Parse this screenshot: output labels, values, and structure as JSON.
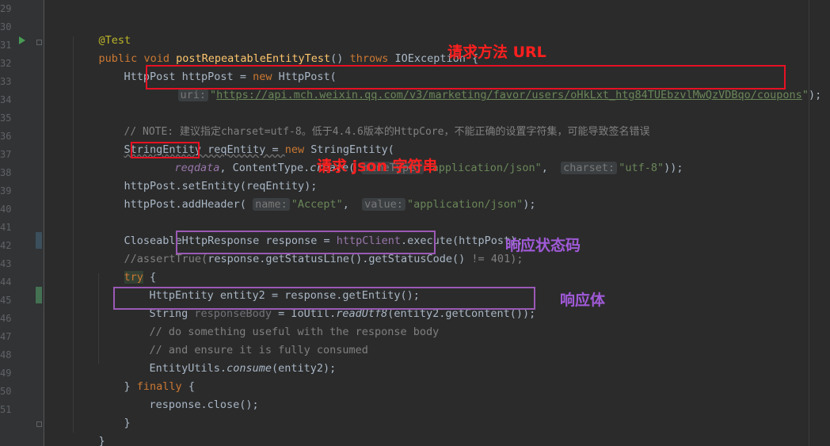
{
  "gutter": {
    "line_numbers": [
      "29",
      "30",
      "31",
      "32",
      "33",
      "34",
      "35",
      "36",
      "37",
      "38",
      "39",
      "40",
      "41",
      "42",
      "43",
      "44",
      "45",
      "46",
      "47",
      "48",
      "49",
      "50",
      "51"
    ]
  },
  "code": {
    "l29_annotation": "@Test",
    "l30_public": "public",
    "l30_void": "void",
    "l30_method": "postRepeatableEntityTest",
    "l30_parens": "() ",
    "l30_throws": "throws",
    "l30_rest": " IOException {",
    "l31_a": "HttpPost httpPost = ",
    "l31_new": "new",
    "l31_b": " HttpPost(",
    "l32_hint": "uri:",
    "l32_q1": "\"",
    "l32_url": "https://api.mch.weixin.qq.com/v3/marketing/favor/users/oHkLxt_htg84TUEbzvlMwQzVDBqo/coupons",
    "l32_q2": "\"",
    "l32_end": ");",
    "l34_comment": "// NOTE: 建议指定charset=utf-8。低于4.4.6版本的HttpCore，不能正确的设置字符集，可能导致签名错误",
    "l35_a": "StringEntity reqEntity = ",
    "l35_new": "new",
    "l35_b": " StringEntity(",
    "l36_param": "reqdata",
    "l36_a": ", ContentType.",
    "l36_create": "create",
    "l36_open": "(",
    "l36_hint1": "mimeType:",
    "l36_str1": "\"application/json\"",
    "l36_comma": ", ",
    "l36_hint2": "charset:",
    "l36_str2": "\"utf-8\"",
    "l36_end": "));",
    "l37": "httpPost.setEntity(reqEntity);",
    "l38_a": "httpPost.addHeader(",
    "l38_hint1": "name:",
    "l38_str1": "\"Accept\"",
    "l38_comma": ", ",
    "l38_hint2": "value:",
    "l38_str2": "\"application/json\"",
    "l38_end": ");",
    "l40_a": "CloseableHttpResponse response = ",
    "l40_client": "httpClient",
    "l40_b": ".execute(httpPost);",
    "l41_a": "//assertTrue(",
    "l41_b": "response.getStatusLine().getStatusCode()",
    "l41_c": " != 401);",
    "l42_try": "try",
    "l42_rest": " {",
    "l43": "HttpEntity entity2 = response.getEntity();",
    "l44_a": "String ",
    "l44_var": "responseBody",
    "l44_b": " = IoUtil.",
    "l44_read": "readUtf8",
    "l44_c": "(entity2.getContent());",
    "l45": "// do something useful with the response body",
    "l46": "// and ensure it is fully consumed",
    "l47_a": "EntityUtils.",
    "l47_consume": "consume",
    "l47_b": "(entity2);",
    "l48_a": "} ",
    "l48_finally": "finally",
    "l48_b": " {",
    "l49": "response.close();",
    "l50": "}",
    "l51": "}"
  },
  "annotations": {
    "request_url": "请求方法 URL",
    "request_json": "请求 json 字符串",
    "status_code": "响应状态码",
    "response_body": "响应体"
  },
  "colors": {
    "background": "#2b2b2b",
    "keyword": "#cc7832",
    "string": "#6a8759",
    "method": "#ffc66d",
    "comment": "#808080",
    "red_box": "#e81123",
    "purple_box": "#9b59b6"
  }
}
